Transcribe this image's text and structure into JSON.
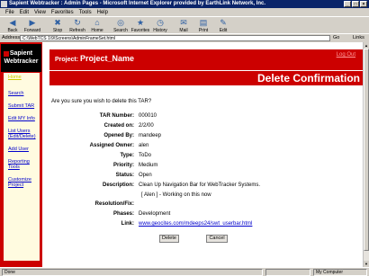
{
  "window": {
    "title": "Sapient Webtracker : Admin Pages - Microsoft Internet Explorer provided by EarthLink Network, Inc."
  },
  "menu": [
    "File",
    "Edit",
    "View",
    "Favorites",
    "Tools",
    "Help"
  ],
  "toolbar": [
    {
      "label": "Back",
      "icon": "back-arrow"
    },
    {
      "label": "Forward",
      "icon": "forward-arrow"
    },
    {
      "label": "Stop",
      "icon": "stop"
    },
    {
      "label": "Refresh",
      "icon": "refresh"
    },
    {
      "label": "Home",
      "icon": "home"
    },
    {
      "label": "Search",
      "icon": "search"
    },
    {
      "label": "Favorites",
      "icon": "favorites"
    },
    {
      "label": "History",
      "icon": "history"
    },
    {
      "label": "Mail",
      "icon": "mail"
    },
    {
      "label": "Print",
      "icon": "print"
    },
    {
      "label": "Edit",
      "icon": "edit"
    }
  ],
  "address": {
    "label": "Address",
    "url": "C:\\WebTCS 1\\9\\Screens\\AdminFrameSet.html",
    "go": "Go",
    "links": "Links"
  },
  "sidebar": {
    "logo": "Sapient Webtracker",
    "items": [
      "Home",
      "Search",
      "Submit TAR",
      "Edit MY Info",
      "List Users (Edit/Delete)",
      "Add User",
      "Reporting Tools",
      "Customize Project"
    ]
  },
  "header": {
    "project_label": "Project:",
    "project_name": "Project_Name",
    "logout": "Log Out",
    "page_title": "Delete Confirmation"
  },
  "question": "Are you sure you wish to delete this TAR?",
  "details": [
    {
      "label": "TAR Number:",
      "value": "000010"
    },
    {
      "label": "Created on:",
      "value": "2/2/00"
    },
    {
      "label": "Opened By:",
      "value": "mandeep"
    },
    {
      "label": "Assigned Owner:",
      "value": "alen"
    },
    {
      "label": "Type:",
      "value": "ToDo"
    },
    {
      "label": "Priority:",
      "value": "Medium"
    },
    {
      "label": "Status:",
      "value": "Open"
    },
    {
      "label": "Description:",
      "value": "Clean Up Navigation Bar for WebTracker Systems."
    }
  ],
  "note": "[ Alen ] - Working on this now",
  "details2": [
    {
      "label": "Resolution/Fix:",
      "value": ""
    },
    {
      "label": "Phases:",
      "value": "Development"
    },
    {
      "label": "Link:",
      "value": "www.geocites.com/mdeeps24/swt_userbar.html"
    }
  ],
  "buttons": {
    "delete": "Delete",
    "cancel": "Cancel"
  },
  "status": {
    "left": "Done",
    "zone": "My Computer"
  }
}
